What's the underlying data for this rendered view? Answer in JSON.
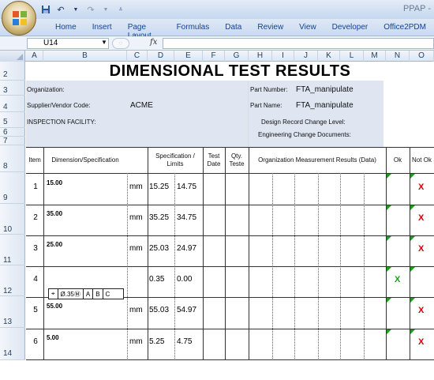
{
  "titlebar": {
    "app_title": "PPAP -"
  },
  "ribbon": {
    "tabs": [
      "Home",
      "Insert",
      "Page Layout",
      "Formulas",
      "Data",
      "Review",
      "View",
      "Developer",
      "Office2PDM"
    ]
  },
  "formula_bar": {
    "name_box": "U14",
    "fx_label": "fx",
    "formula": ""
  },
  "columns": [
    "A",
    "B",
    "C",
    "D",
    "E",
    "F",
    "G",
    "H",
    "I",
    "J",
    "K",
    "L",
    "M",
    "N",
    "O"
  ],
  "rows": [
    "2",
    "3",
    "4",
    "5",
    "6",
    "7",
    "8",
    "9",
    "10",
    "11",
    "12",
    "13",
    "14"
  ],
  "sheet": {
    "title": "DIMENSIONAL TEST RESULTS",
    "organization_label": "Organization:",
    "supplier_label": "Supplier/Vendor Code:",
    "supplier_value": "ACME",
    "inspection_label": "INSPECTION FACILITY:",
    "part_number_label": "Part Number:",
    "part_number_value": "FTA_manipulate",
    "part_name_label": "Part Name:",
    "part_name_value": "FTA_manipulate",
    "design_record_label": "Design Record Change Level:",
    "engineering_change_label": "Engineering Change Documents:",
    "headers": {
      "item": "Item",
      "dimension": "Dimension/Specification",
      "spec_limits": "Specification / Limits",
      "test_date": "Test Date",
      "qty_tested": "Qty. Teste",
      "org_results": "Organization Measurement Results (Data)",
      "ok": "Ok",
      "not_ok": "Not Ok"
    },
    "items": [
      {
        "item": "1",
        "dimension": "15.00",
        "unit": "mm",
        "upper": "15.25",
        "lower": "14.75",
        "ok": "",
        "not_ok": "X"
      },
      {
        "item": "2",
        "dimension": "35.00",
        "unit": "mm",
        "upper": "35.25",
        "lower": "34.75",
        "ok": "",
        "not_ok": "X"
      },
      {
        "item": "3",
        "dimension": "25.00",
        "unit": "mm",
        "upper": "25.03",
        "lower": "24.97",
        "ok": "",
        "not_ok": "X"
      },
      {
        "item": "4",
        "dimension": "",
        "unit": "",
        "upper": "0.35",
        "lower": "0.00",
        "ok": "X",
        "not_ok": ""
      },
      {
        "item": "5",
        "dimension": "55.00",
        "unit": "mm",
        "upper": "55.03",
        "lower": "54.97",
        "ok": "",
        "not_ok": "X"
      },
      {
        "item": "6",
        "dimension": "5.00",
        "unit": "mm",
        "upper": "5.25",
        "lower": "4.75",
        "ok": "",
        "not_ok": "X"
      }
    ],
    "gdt_frame": [
      "⌖",
      "Ø.35Ⓜ",
      "A",
      "B",
      "C"
    ]
  }
}
